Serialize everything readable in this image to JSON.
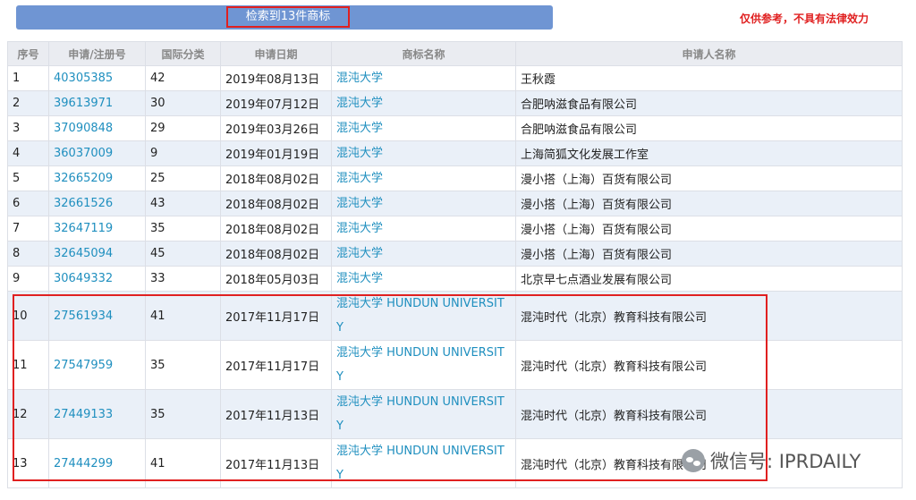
{
  "header": {
    "search_count": "检索到13件商标",
    "disclaimer": "仅供参考，不具有法律效力"
  },
  "table": {
    "columns": [
      "序号",
      "申请/注册号",
      "国际分类",
      "申请日期",
      "商标名称",
      "申请人名称"
    ],
    "rows": [
      {
        "no": "1",
        "reg": "40305385",
        "cls": "42",
        "date": "2019年08月13日",
        "mark": "混沌大学",
        "applicant": "王秋霞"
      },
      {
        "no": "2",
        "reg": "39613971",
        "cls": "30",
        "date": "2019年07月12日",
        "mark": "混沌大学",
        "applicant": "合肥呐滋食品有限公司"
      },
      {
        "no": "3",
        "reg": "37090848",
        "cls": "29",
        "date": "2019年03月26日",
        "mark": "混沌大学",
        "applicant": "合肥呐滋食品有限公司"
      },
      {
        "no": "4",
        "reg": "36037009",
        "cls": "9",
        "date": "2019年01月19日",
        "mark": "混沌大学",
        "applicant": "上海简狐文化发展工作室"
      },
      {
        "no": "5",
        "reg": "32665209",
        "cls": "25",
        "date": "2018年08月02日",
        "mark": "混沌大学",
        "applicant": "漫小搭（上海）百货有限公司"
      },
      {
        "no": "6",
        "reg": "32661526",
        "cls": "43",
        "date": "2018年08月02日",
        "mark": "混沌大学",
        "applicant": "漫小搭（上海）百货有限公司"
      },
      {
        "no": "7",
        "reg": "32647119",
        "cls": "35",
        "date": "2018年08月02日",
        "mark": "混沌大学",
        "applicant": "漫小搭（上海）百货有限公司"
      },
      {
        "no": "8",
        "reg": "32645094",
        "cls": "45",
        "date": "2018年08月02日",
        "mark": "混沌大学",
        "applicant": "漫小搭（上海）百货有限公司"
      },
      {
        "no": "9",
        "reg": "30649332",
        "cls": "33",
        "date": "2018年05月03日",
        "mark": "混沌大学",
        "applicant": "北京早七点酒业发展有限公司"
      },
      {
        "no": "10",
        "reg": "27561934",
        "cls": "41",
        "date": "2017年11月17日",
        "mark": "混沌大学 HUNDUN UNIVERSITY",
        "applicant": "混沌时代（北京）教育科技有限公司"
      },
      {
        "no": "11",
        "reg": "27547959",
        "cls": "35",
        "date": "2017年11月17日",
        "mark": "混沌大学 HUNDUN UNIVERSITY",
        "applicant": "混沌时代（北京）教育科技有限公司"
      },
      {
        "no": "12",
        "reg": "27449133",
        "cls": "35",
        "date": "2017年11月13日",
        "mark": "混沌大学 HUNDUN UNIVERSITY",
        "applicant": "混沌时代（北京）教育科技有限公司"
      },
      {
        "no": "13",
        "reg": "27444299",
        "cls": "41",
        "date": "2017年11月13日",
        "mark": "混沌大学 HUNDUN UNIVERSITY",
        "applicant": "混沌时代（北京）教育科技有限公司"
      }
    ]
  },
  "watermark": {
    "text": "微信号: IPRDAILY",
    "icon": "wechat-icon"
  },
  "colors": {
    "accent_bar": "#6f95d3",
    "link": "#1f8fbf",
    "highlight": "#e02020",
    "alt_row": "#eaf0f8",
    "header_bg": "#eaecf1"
  }
}
